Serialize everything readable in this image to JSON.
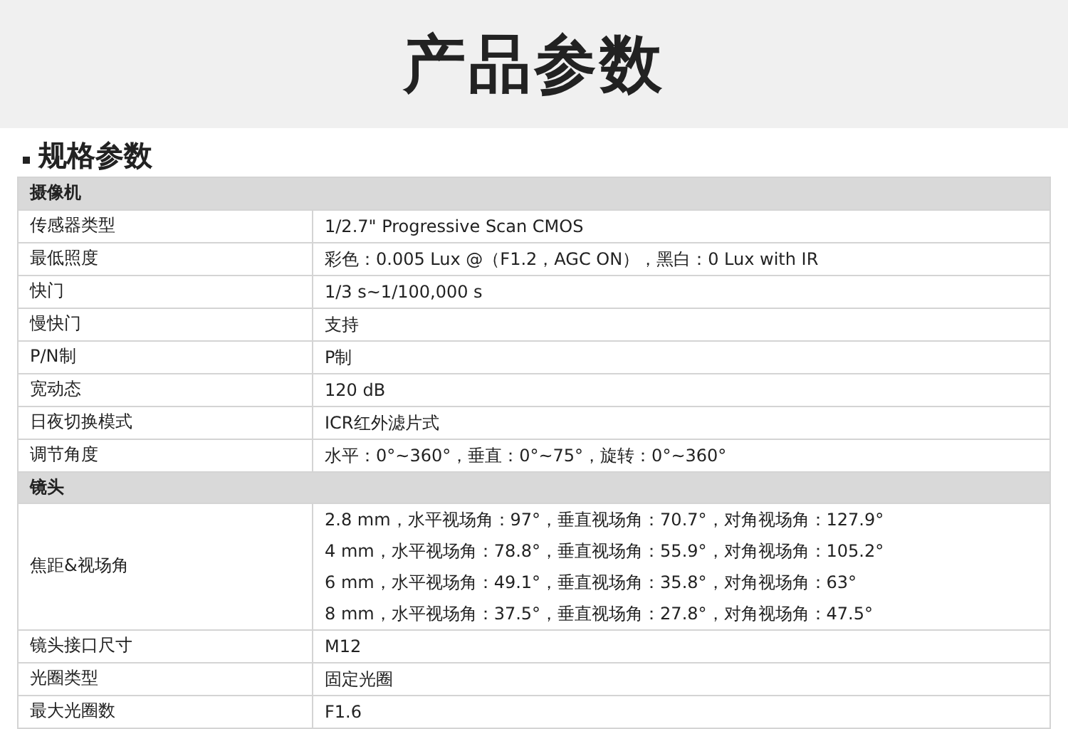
{
  "page_title": "产品参数",
  "section_title": "规格参数",
  "groups": [
    {
      "title": "摄像机",
      "rows": [
        {
          "label": "传感器类型",
          "values": [
            "1/2.7\" Progressive Scan CMOS"
          ]
        },
        {
          "label": "最低照度",
          "values": [
            "彩色：0.005 Lux @（F1.2，AGC ON），黑白：0 Lux with IR"
          ]
        },
        {
          "label": "快门",
          "values": [
            "1/3 s~1/100,000 s"
          ]
        },
        {
          "label": "慢快门",
          "values": [
            "支持"
          ]
        },
        {
          "label": "P/N制",
          "values": [
            "P制"
          ]
        },
        {
          "label": "宽动态",
          "values": [
            "120 dB"
          ]
        },
        {
          "label": "日夜切换模式",
          "values": [
            "ICR红外滤片式"
          ]
        },
        {
          "label": "调节角度",
          "values": [
            "水平：0°~360°，垂直：0°~75°，旋转：0°~360°"
          ]
        }
      ]
    },
    {
      "title": "镜头",
      "rows": [
        {
          "label": "焦距&视场角",
          "values": [
            "2.8 mm，水平视场角：97°，垂直视场角：70.7°，对角视场角：127.9°",
            "4 mm，水平视场角：78.8°，垂直视场角：55.9°，对角视场角：105.2°",
            "6 mm，水平视场角：49.1°，垂直视场角：35.8°，对角视场角：63°",
            "8 mm，水平视场角：37.5°，垂直视场角：27.8°，对角视场角：47.5°"
          ]
        },
        {
          "label": "镜头接口尺寸",
          "values": [
            "M12"
          ]
        },
        {
          "label": "光圈类型",
          "values": [
            "固定光圈"
          ]
        },
        {
          "label": "最大光圈数",
          "values": [
            "F1.6"
          ]
        }
      ]
    }
  ]
}
